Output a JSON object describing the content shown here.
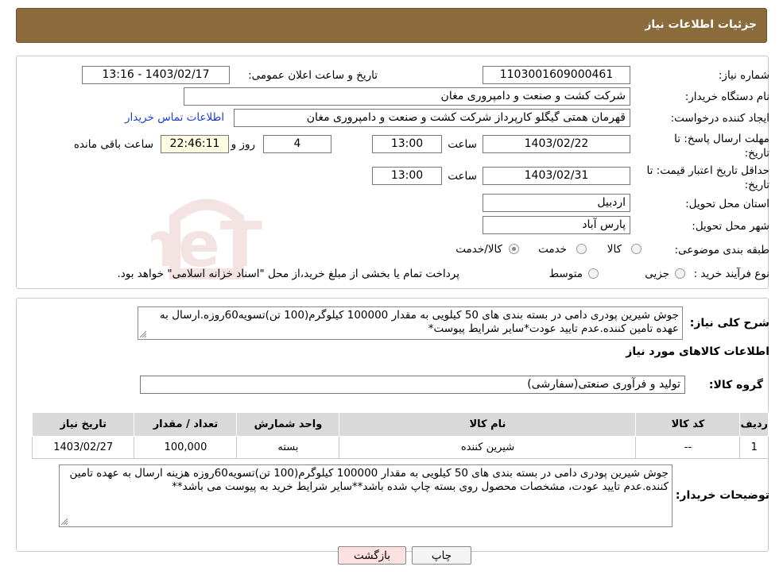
{
  "header": {
    "title": "جزئیات اطلاعات نیاز"
  },
  "form": {
    "need_number_label": "شماره نیاز:",
    "need_number": "1103001609000461",
    "announce_label": "تاریخ و ساعت اعلان عمومی:",
    "announce_value": "1403/02/17 - 13:16",
    "buyer_org_label": "نام دستگاه خریدار:",
    "buyer_org": "شرکت کشت و صنعت و دامپروری مغان",
    "creator_label": "ایجاد کننده درخواست:",
    "creator": "قهرمان همتی گیگلو کارپرداز شرکت کشت و صنعت و دامپروری مغان",
    "contact_link": "اطلاعات تماس خریدار",
    "deadline_label": "مهلت ارسال پاسخ: تا تاریخ:",
    "deadline_date": "1403/02/22",
    "time_label": "ساعت",
    "deadline_time": "13:00",
    "days_value": "4",
    "days_label": "روز و",
    "remaining_value": "22:46:11",
    "remaining_label": "ساعت باقی مانده",
    "validity_label": "حداقل تاریخ اعتبار قیمت: تا تاریخ:",
    "validity_date": "1403/02/31",
    "validity_time": "13:00",
    "province_label": "استان محل تحویل:",
    "province": "اردبیل",
    "city_label": "شهر محل تحویل:",
    "city": "پارس آباد",
    "category_label": "طبقه بندی موضوعی:",
    "category_options": [
      "کالا",
      "خدمت",
      "کالا/خدمت"
    ],
    "process_label": "نوع فرآیند خرید :",
    "process_options": [
      "جزیی",
      "متوسط"
    ],
    "process_note": "پرداخت تمام یا بخشی از مبلغ خرید،از محل \"اسناد خزانه اسلامی\" خواهد بود."
  },
  "summary": {
    "label": "شرح کلی نیاز:",
    "text": "جوش شیرین پودری دامی در بسته بندی های 50 کیلویی به مقدار 100000 کیلوگرم(100 تن)تسویه60روزه.ارسال به عهده تامین کننده.عدم تایید عودت*سایر شرایط پیوست*"
  },
  "goods": {
    "section_title": "اطلاعات کالاهای مورد نیاز",
    "group_label": "گروه کالا:",
    "group_value": "تولید و فرآوری صنعتی(سفارشی)",
    "columns": [
      "ردیف",
      "کد کالا",
      "نام کالا",
      "واحد شمارش",
      "تعداد / مقدار",
      "تاریخ نیاز"
    ],
    "rows": [
      [
        "1",
        "--",
        "شیرین کننده",
        "بسته",
        "100,000",
        "1403/02/27"
      ]
    ]
  },
  "buyer_notes": {
    "label": "توضیحات خریدار:",
    "text": "جوش شیرین پودری دامی در بسته بندی های 50 کیلویی به مقدار 100000 کیلوگرم(100 تن)تسویه60روزه هزینه ارسال به عهده تامین کننده.عدم تایید عودت، مشخصات محصول روی بسته چاپ شده باشد**سایر شرایط خرید به پیوست می باشد**"
  },
  "actions": {
    "print": "چاپ",
    "back": "بازگشت"
  },
  "watermark": {
    "text": "AriaTender.neT"
  },
  "colors": {
    "header_bg": "#8b6a3c",
    "link": "#1a3fd3",
    "back_btn": "#fde0e0"
  }
}
